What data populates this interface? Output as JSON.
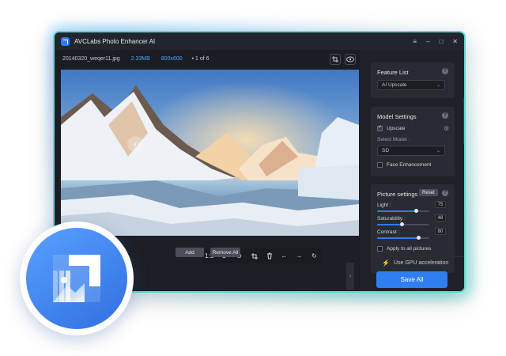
{
  "app": {
    "title": "AVCLabs Photo Enhancer AI",
    "window_controls": [
      "≡",
      "–",
      "□",
      "✕"
    ]
  },
  "infobar": {
    "filename": "20140320_weqer11.jpg",
    "filesize": "2.33MB",
    "dimensions": "800x600",
    "count": "• 1 of 6"
  },
  "viewer": {
    "prev_icon": "chevron-left-icon",
    "next_icon": "chevron-right-icon"
  },
  "toolbar": {
    "ratio_label": "1:1",
    "icons": [
      "zoom-in-icon",
      "zoom-out-icon",
      "crop-icon",
      "trash-icon",
      "arrow-left-icon",
      "arrow-right-icon",
      "rotate-icon"
    ]
  },
  "actions": {
    "add_label": "Add",
    "remove_all_label": "Remove All"
  },
  "feature_list": {
    "title": "Feature List",
    "selected": "AI Upscale"
  },
  "model_settings": {
    "title": "Model Settings",
    "upscale_label": "Upscale",
    "upscale_checked": true,
    "select_model_label": "Select Model :",
    "model_value": "SD",
    "face_enhancement_label": "Face Enhancement",
    "face_enhancement_checked": false
  },
  "picture_settings": {
    "title": "Picture settings",
    "reset_label": "Reset",
    "sliders": [
      {
        "label": "Light :",
        "value": "75",
        "fraction": 0.75
      },
      {
        "label": "Saturability :",
        "value": "48",
        "fraction": 0.48
      },
      {
        "label": "Contrast :",
        "value": "80",
        "fraction": 0.8
      }
    ],
    "apply_all_label": "Apply to all pictures",
    "apply_all_checked": false
  },
  "footer": {
    "gpu_label": "Use GPU acceleration",
    "save_all_label": "Save All"
  },
  "colors": {
    "accent": "#2e7ff0",
    "highlight": "#4fa3f7",
    "window_bg": "#1b1d24",
    "panel_bg": "#1f2128"
  }
}
